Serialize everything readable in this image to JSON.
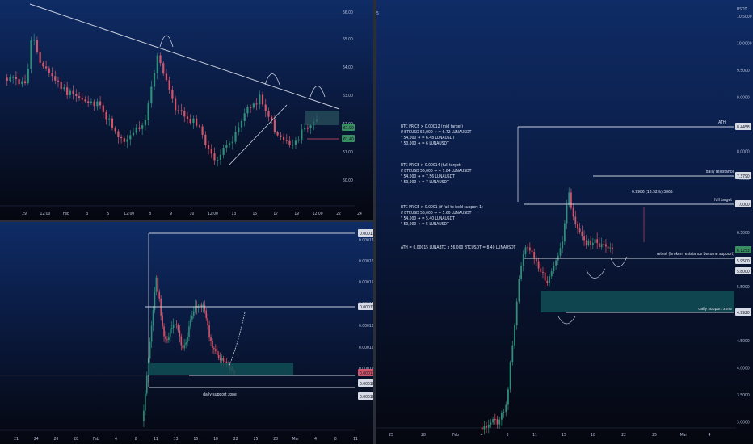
{
  "colors": {
    "up": "#2f8f7a",
    "down": "#d2566b",
    "line": "#c8cfdc",
    "zone": "#2b5560",
    "teal": "#0f4f55"
  },
  "panel_top_left": {
    "y_ticks": [
      "66.00",
      "65.00",
      "64.00",
      "63.00",
      "62.00",
      "61.00",
      "60.00"
    ],
    "x_ticks": [
      "29",
      "12:00",
      "Feb",
      "3",
      "5",
      "12:00",
      "8",
      "9",
      "10",
      "12:00",
      "13",
      "15",
      "17",
      "19",
      "12:00",
      "22",
      "24"
    ],
    "price_tags": [
      "61.90",
      "61.40"
    ]
  },
  "panel_bottom_left": {
    "y_ticks": [
      "0.0001700",
      "0.0001600",
      "0.0001500",
      "0.0001400",
      "0.0001300",
      "0.0001200",
      "0.0001100"
    ],
    "x_ticks": [
      "21",
      "24",
      "26",
      "28",
      "Feb",
      "4",
      "8",
      "11",
      "13",
      "15",
      "18",
      "22",
      "25",
      "28",
      "Mar",
      "4",
      "8",
      "11"
    ],
    "price_tags": [
      "0.00017708",
      "0.00013625",
      "0.00011283",
      "0.00010775",
      "0.00010255"
    ],
    "annotation": "daily support zone"
  },
  "panel_right": {
    "currency": "USDT",
    "y_ticks": [
      "10.5000",
      "10.0000",
      "9.5000",
      "9.0000",
      "8.5000",
      "8.0000",
      "7.5000",
      "7.0000",
      "6.5000",
      "6.0000",
      "5.5000",
      "5.0000",
      "4.5000",
      "4.0000",
      "3.5000",
      "3.0000"
    ],
    "x_ticks": [
      "25",
      "28",
      "Feb",
      "4",
      "8",
      "11",
      "15",
      "18",
      "22",
      "25",
      "Mar",
      "4"
    ],
    "price_tags": [
      "8.4458",
      "7.3790",
      "7.0000",
      "6.1253",
      "5.9500",
      "5.8000",
      "4.9920"
    ],
    "text_block_1": [
      "BTC PRICE × 0.00012 (mid target)",
      "    if BTCUSD 56,000 → = 6.72 LUNAUSDT",
      "    \"         54,000 → = 6.48 LUNAUSDT",
      "    \"         50,000 → = 6 LUNAUSDT"
    ],
    "text_block_2": [
      "BTC PRICE × 0.00014 (full target)",
      "    if BTCUSD 56,000 → = 7.84 LUNAUSDT",
      "    \"         54,000 → = 7.56 LUNAUSDT",
      "    \"         50,000 → = 7 LUNAUSDT"
    ],
    "text_block_3": [
      "BTC PRICE × 0.0001 (if fail to hold support 1)",
      "    if BTCUSD 56,000 → = 5.60 LUNAUSDT",
      "    \"         54,000 → = 5.40 LUNAUSDT",
      "    \"         50,000 → = 5 LUNAUSDT"
    ],
    "ath_line": "ATH = 0.00015 LUNABTC x 56,000 BTCUSDT = 8.40 LUNAUSDT",
    "labels": {
      "ath": "ATH",
      "daily_resistance": "daily resistance",
      "full_target": "full target",
      "retest": "retest (broken resistance become support)",
      "daily_support": "daily support zone",
      "measure": "0.9986 (16.52%) 3865"
    }
  }
}
